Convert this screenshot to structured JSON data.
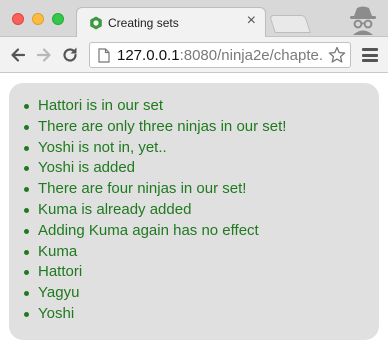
{
  "browser": {
    "tab_title": "Creating sets",
    "tab_close": "×",
    "url_host": "127.0.0.1",
    "url_rest": ":8080/ninja2e/chapte...",
    "icons": {
      "back": "arrow-left-icon",
      "forward": "arrow-right-icon",
      "reload": "reload-icon",
      "page": "page-icon",
      "bookmark": "star-icon",
      "menu": "hamburger-menu-icon",
      "profile": "incognito-profile-icon",
      "favicon": "favicon-icon"
    }
  },
  "colors": {
    "text_green": "#1f7a1f",
    "panel_bg": "#e0e0e0"
  },
  "results": [
    "Hattori is in our set",
    "There are only three ninjas in our set!",
    "Yoshi is not in, yet..",
    "Yoshi is added",
    "There are four ninjas in our set!",
    "Kuma is already added",
    "Adding Kuma again has no effect",
    "Kuma",
    "Hattori",
    "Yagyu",
    "Yoshi"
  ]
}
